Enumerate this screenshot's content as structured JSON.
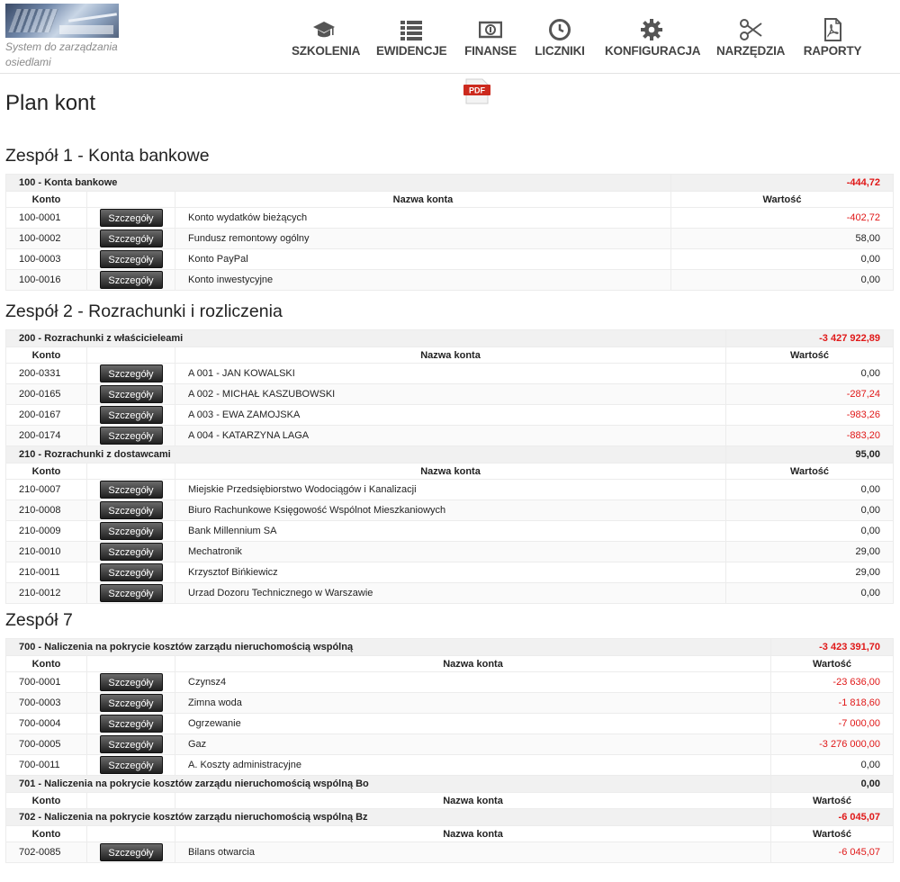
{
  "header": {
    "logo_text": "System do zarządzania osiedlami",
    "nav": [
      {
        "label": "SZKOLENIA",
        "icon": "graduation-cap-icon"
      },
      {
        "label": "EWIDENCJE",
        "icon": "list-icon"
      },
      {
        "label": "FINANSE",
        "icon": "money-icon"
      },
      {
        "label": "LICZNIKI",
        "icon": "clock-icon"
      },
      {
        "label": "KONFIGURACJA",
        "icon": "gear-icon"
      },
      {
        "label": "NARZĘDZIA",
        "icon": "scissors-icon"
      },
      {
        "label": "RAPORTY",
        "icon": "pdf-file-icon"
      }
    ]
  },
  "page": {
    "title": "Plan kont",
    "pdf_label": "PDF"
  },
  "columns": {
    "konto": "Konto",
    "nazwa": "Nazwa konta",
    "wartosc": "Wartość"
  },
  "details_label": "Szczegóły",
  "colors": {
    "negative": "#e01818",
    "button": "#2a2a2a"
  },
  "groups": [
    {
      "title": "Zespół 1 - Konta bankowe",
      "sections": [
        {
          "name": "100 - Konta bankowe",
          "total": "-444,72",
          "total_negative": true,
          "rows": [
            {
              "konto": "100-0001",
              "nazwa": "Konto wydatków bieżących",
              "wartosc": "-402,72",
              "negative": true
            },
            {
              "konto": "100-0002",
              "nazwa": "Fundusz remontowy ogólny",
              "wartosc": "58,00",
              "negative": false
            },
            {
              "konto": "100-0003",
              "nazwa": "Konto PayPal",
              "wartosc": "0,00",
              "negative": false
            },
            {
              "konto": "100-0016",
              "nazwa": "Konto inwestycyjne",
              "wartosc": "0,00",
              "negative": false
            }
          ]
        }
      ]
    },
    {
      "title": "Zespół 2 - Rozrachunki i rozliczenia",
      "sections": [
        {
          "name": "200 - Rozrachunki z właścicieleami",
          "total": "-3 427 922,89",
          "total_negative": true,
          "rows": [
            {
              "konto": "200-0331",
              "nazwa": "A 001 - JAN KOWALSKI",
              "wartosc": "0,00",
              "negative": false
            },
            {
              "konto": "200-0165",
              "nazwa": "A 002 - MICHAŁ KASZUBOWSKI",
              "wartosc": "-287,24",
              "negative": true
            },
            {
              "konto": "200-0167",
              "nazwa": "A 003 - EWA ZAMOJSKA",
              "wartosc": "-983,26",
              "negative": true
            },
            {
              "konto": "200-0174",
              "nazwa": "A 004 - KATARZYNA LAGA",
              "wartosc": "-883,20",
              "negative": true
            }
          ]
        },
        {
          "name": "210 - Rozrachunki z dostawcami",
          "total": "95,00",
          "total_negative": false,
          "rows": [
            {
              "konto": "210-0007",
              "nazwa": "Miejskie Przedsiębiorstwo Wodociągów i Kanalizacji",
              "wartosc": "0,00",
              "negative": false
            },
            {
              "konto": "210-0008",
              "nazwa": "Biuro Rachunkowe Księgowość Wspólnot Mieszkaniowych",
              "wartosc": "0,00",
              "negative": false
            },
            {
              "konto": "210-0009",
              "nazwa": "Bank Millennium SA",
              "wartosc": "0,00",
              "negative": false
            },
            {
              "konto": "210-0010",
              "nazwa": "Mechatronik",
              "wartosc": "29,00",
              "negative": false
            },
            {
              "konto": "210-0011",
              "nazwa": "Krzysztof Bińkiewicz",
              "wartosc": "29,00",
              "negative": false
            },
            {
              "konto": "210-0012",
              "nazwa": "Urzad Dozoru Technicznego w Warszawie",
              "wartosc": "0,00",
              "negative": false
            }
          ]
        }
      ]
    },
    {
      "title": "Zespół 7",
      "sections": [
        {
          "name": "700 - Naliczenia na pokrycie kosztów zarządu nieruchomością wspólną",
          "total": "-3 423 391,70",
          "total_negative": true,
          "rows": [
            {
              "konto": "700-0001",
              "nazwa": "Czynsz4",
              "wartosc": "-23 636,00",
              "negative": true
            },
            {
              "konto": "700-0003",
              "nazwa": "Zimna woda",
              "wartosc": "-1 818,60",
              "negative": true
            },
            {
              "konto": "700-0004",
              "nazwa": "Ogrzewanie",
              "wartosc": "-7 000,00",
              "negative": true
            },
            {
              "konto": "700-0005",
              "nazwa": "Gaz",
              "wartosc": "-3 276 000,00",
              "negative": true
            },
            {
              "konto": "700-0011",
              "nazwa": "A. Koszty administracyjne",
              "wartosc": "0,00",
              "negative": false
            }
          ]
        },
        {
          "name": "701 - Naliczenia na pokrycie kosztów zarządu nieruchomością wspólną Bo",
          "total": "0,00",
          "total_negative": false,
          "rows": []
        },
        {
          "name": "702 - Naliczenia na pokrycie kosztów zarządu nieruchomością wspólną Bz",
          "total": "-6 045,07",
          "total_negative": true,
          "rows": [
            {
              "konto": "702-0085",
              "nazwa": "Bilans otwarcia",
              "wartosc": "-6 045,07",
              "negative": true
            }
          ]
        }
      ]
    }
  ]
}
